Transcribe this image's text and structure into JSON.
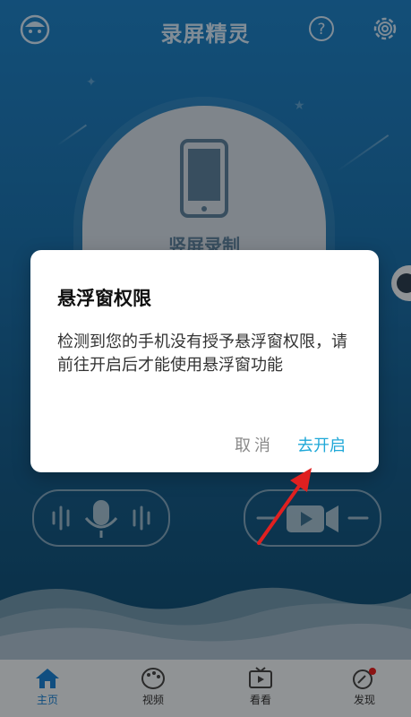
{
  "header": {
    "title": "录屏精灵",
    "avatar_icon": "avatar-icon",
    "help_icon": "help-icon",
    "settings_icon": "gear-icon"
  },
  "record_card": {
    "label": "竖屏录制"
  },
  "dialog": {
    "title": "悬浮窗权限",
    "message": "检测到您的手机没有授予悬浮窗权限，请前往开启后才能使用悬浮窗功能",
    "cancel_label": "取消",
    "confirm_label": "去开启",
    "confirm_color": "#1fa8d8"
  },
  "bottom_nav": {
    "items": [
      {
        "label": "主页",
        "icon": "home-icon",
        "active": true
      },
      {
        "label": "视频",
        "icon": "palette-icon",
        "active": false
      },
      {
        "label": "看看",
        "icon": "tv-play-icon",
        "active": false
      },
      {
        "label": "发现",
        "icon": "discover-icon",
        "active": false,
        "badge": true
      }
    ]
  },
  "colors": {
    "accent": "#1a7fcf",
    "arrow": "#e02020"
  }
}
